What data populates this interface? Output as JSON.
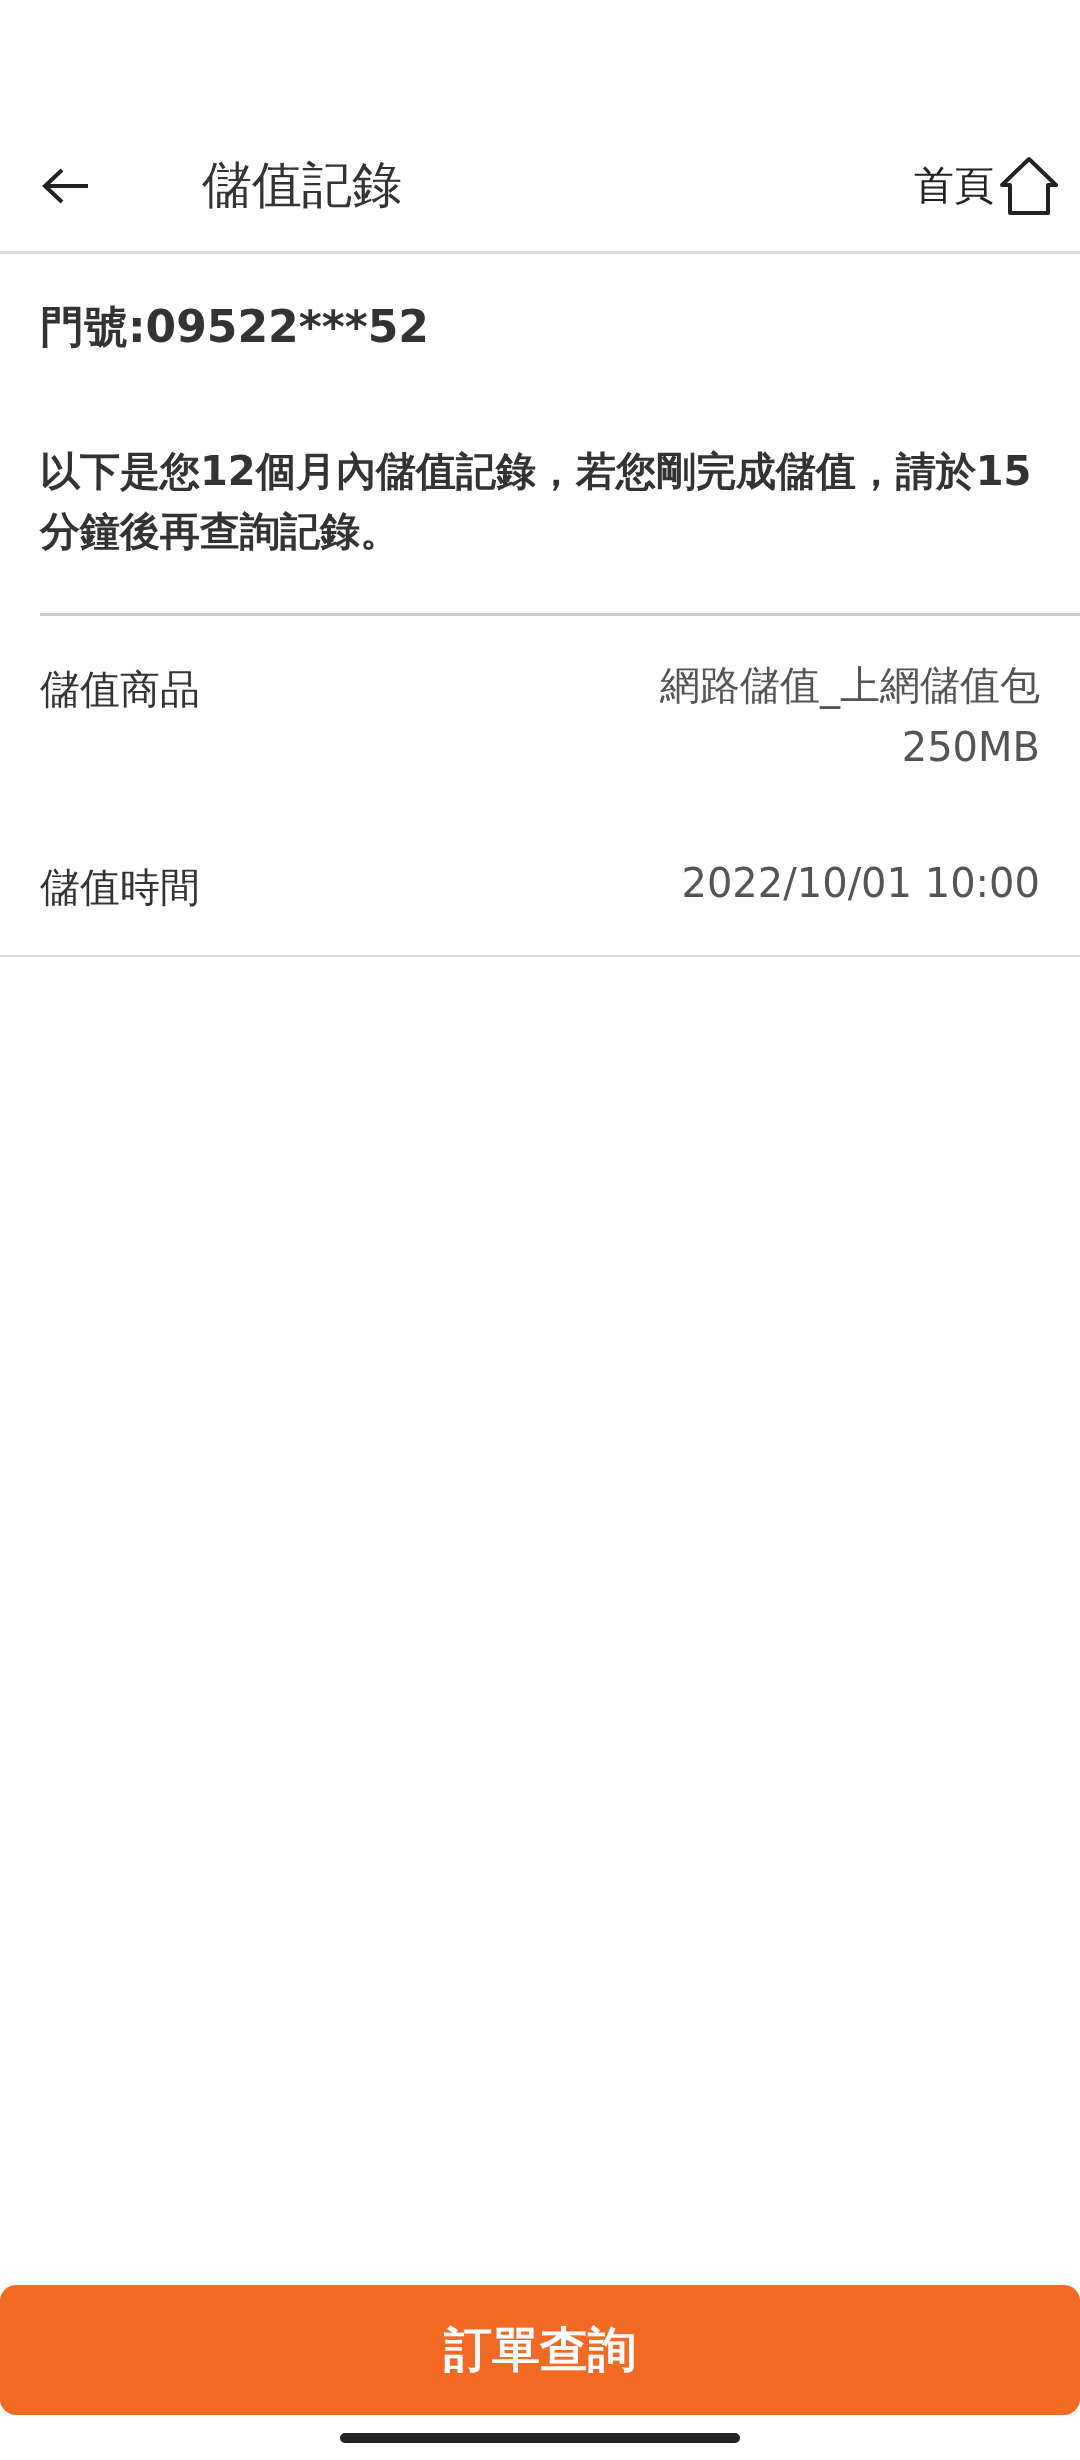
{
  "header": {
    "title": "儲值記錄",
    "home_label": "首頁"
  },
  "phone_number": "門號:09522***52",
  "notice": "以下是您12個月內儲值記錄，若您剛完成儲值，請於15分鐘後再查詢記錄。",
  "details": [
    {
      "label": "儲值商品",
      "value": "網路儲值_上網儲值包250MB"
    },
    {
      "label": "儲值時間",
      "value": "2022/10/01 10:00"
    }
  ],
  "primary_button": "訂單查詢"
}
